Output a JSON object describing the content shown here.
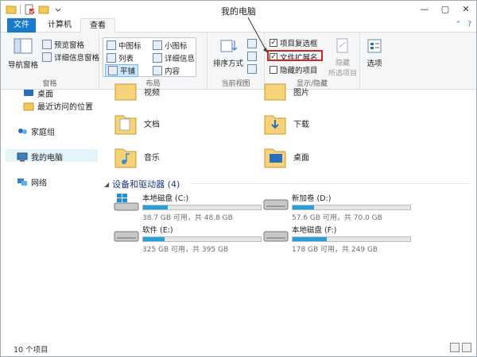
{
  "window": {
    "title": "我的电脑",
    "buttons": {
      "minimize": "—",
      "maximize": "▢",
      "close": "✕"
    }
  },
  "tabs": {
    "file": "文件",
    "computer": "计算机",
    "view": "查看",
    "right_icon": "⌃",
    "help_icon": "?"
  },
  "ribbon": {
    "panes": {
      "label": "窗格",
      "nav_pane": "导航窗格",
      "preview_pane": "预览窗格",
      "details_pane": "详细信息窗格"
    },
    "layout": {
      "label": "布局",
      "items": [
        "中图标",
        "小图标",
        "列表",
        "详细信息",
        "平铺",
        "内容"
      ]
    },
    "current_view": {
      "label": "当前视图",
      "sort": "排序方式"
    },
    "show_hide": {
      "label": "显示/隐藏",
      "item_checkboxes": "项目复选框",
      "file_extensions": "文件扩展名",
      "hidden_items": "隐藏的项目",
      "hide_selected": "隐藏",
      "hide_selected_sub": "所选项目"
    },
    "options": "选项"
  },
  "nav": {
    "items": [
      {
        "label": "桌面",
        "icon": "desktop-icon"
      },
      {
        "label": "最近访问的位置",
        "icon": "recent-icon"
      },
      {
        "label": "家庭组",
        "icon": "homegroup-icon"
      },
      {
        "label": "我的电脑",
        "icon": "computer-icon"
      },
      {
        "label": "网络",
        "icon": "network-icon"
      }
    ]
  },
  "content": {
    "folders": [
      {
        "label": "视频"
      },
      {
        "label": "图片"
      },
      {
        "label": "文档"
      },
      {
        "label": "下载"
      },
      {
        "label": "音乐"
      },
      {
        "label": "桌面"
      }
    ],
    "drives_header": "设备和驱动器 (4)",
    "drives": [
      {
        "name": "本地磁盘 (C:)",
        "free": "38.7 GB 可用，共 48.8 GB",
        "used_fraction": 0.21,
        "windows": true
      },
      {
        "name": "新加卷 (D:)",
        "free": "57.6 GB 可用，共 70.0 GB",
        "used_fraction": 0.18,
        "windows": false
      },
      {
        "name": "软件 (E:)",
        "free": "325 GB 可用，共 395 GB",
        "used_fraction": 0.18,
        "windows": false
      },
      {
        "name": "本地磁盘 (F:)",
        "free": "178 GB 可用，共 249 GB",
        "used_fraction": 0.29,
        "windows": false
      }
    ]
  },
  "status": {
    "count": "10 个项目"
  },
  "colors": {
    "accent": "#1979ca",
    "highlight_box": "#d7231f",
    "bar_fill": "#26a0da",
    "section_head": "#1e3287"
  }
}
